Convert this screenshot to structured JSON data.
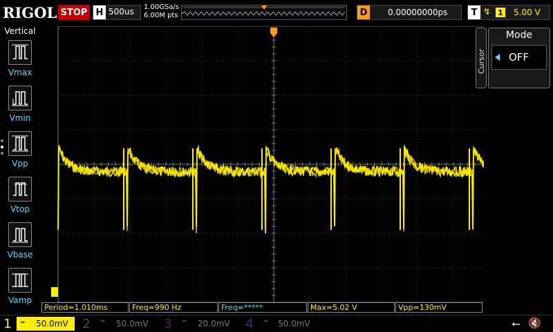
{
  "header": {
    "logo": "RIGOL",
    "run_state": "STOP",
    "horizontal_key": "H",
    "timebase": "500us",
    "sample_rate": "1.00GSa/s",
    "memory_depth": "6.00M pts",
    "delay_key": "D",
    "delay": "0.00000000ps",
    "trigger_key": "T",
    "trigger_edge_icon": "rising-edge-icon",
    "trigger_channel": "1",
    "trigger_level": "5.00 V"
  },
  "left_menu": {
    "title": "Vertical",
    "items": [
      {
        "label": "Vmax",
        "icon": "vmax-icon"
      },
      {
        "label": "Vmin",
        "icon": "vmin-icon"
      },
      {
        "label": "Vpp",
        "icon": "vpp-icon"
      },
      {
        "label": "Vtop",
        "icon": "vtop-icon"
      },
      {
        "label": "Vbase",
        "icon": "vbase-icon"
      },
      {
        "label": "Vamp",
        "icon": "vamp-icon"
      }
    ]
  },
  "right_panel": {
    "section": "Cursor",
    "mode_title": "Mode",
    "mode_value": "OFF"
  },
  "measurements": [
    {
      "text": "Period=1.010ms",
      "color": "#ffee00"
    },
    {
      "text": "Freq=990 Hz",
      "color": "#ffee00"
    },
    {
      "text": "Freq=*****",
      "color": "#5fd8ff"
    },
    {
      "text": "Max=5.02 V",
      "color": "#ffee00"
    },
    {
      "text": "Vpp=130mV",
      "color": "#ffee00"
    }
  ],
  "channels": [
    {
      "num": "1",
      "scale": "50.0mV",
      "color": "#ffee00",
      "active": true
    },
    {
      "num": "2",
      "scale": "50.0mV",
      "color": "#1fb5b5",
      "active": false
    },
    {
      "num": "3",
      "scale": "20.0mV",
      "color": "#d020d0",
      "active": false
    },
    {
      "num": "4",
      "scale": "50.0mV",
      "color": "#4a6cd8",
      "active": false
    }
  ],
  "status_icons": [
    "usb-icon",
    "speaker-muted-icon"
  ],
  "colors": {
    "ch1": "#ffee00",
    "accent": "#ff9b1a",
    "menu_label": "#5fd8ff",
    "grid": "#555555"
  },
  "waveform": {
    "type": "line",
    "period_ms": 1.01,
    "scale_per_div": "50.0mV",
    "timebase_per_div": "500us"
  }
}
